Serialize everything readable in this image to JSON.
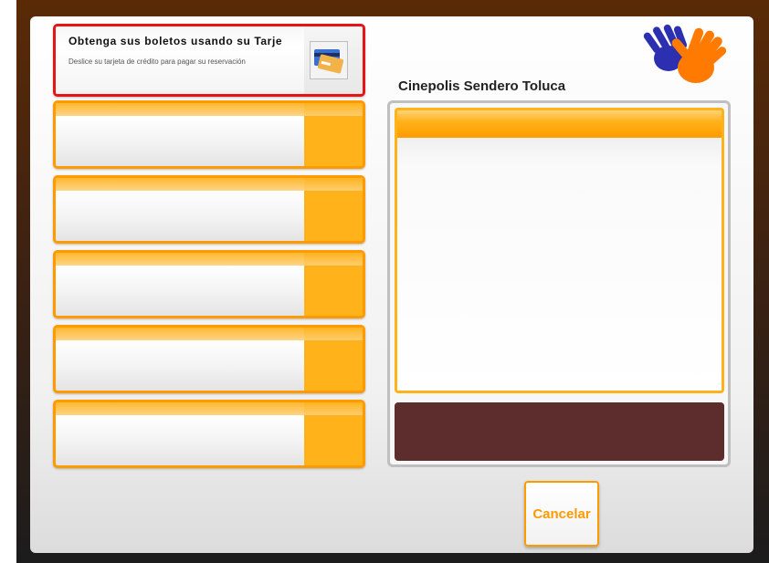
{
  "options": [
    {
      "title": "Obtenga sus boletos usando su Tarje",
      "subtitle": "Deslice su tarjeta de crédito para pagar su reservación",
      "icon": "credit-card-icon",
      "selected": true
    },
    {
      "title": "",
      "subtitle": ""
    },
    {
      "title": "",
      "subtitle": ""
    },
    {
      "title": "",
      "subtitle": ""
    },
    {
      "title": "",
      "subtitle": ""
    },
    {
      "title": "",
      "subtitle": ""
    }
  ],
  "venue": {
    "name": "Cinepolis Sendero Toluca"
  },
  "actions": {
    "cancel_label": "Cancelar"
  },
  "logo": {
    "icon": "hands-logo-icon"
  },
  "colors": {
    "accent": "#FFB21A",
    "accent_dark": "#FF9B00",
    "selected_border": "#E61414",
    "bottom_bar": "#5D2C2C",
    "logo_blue": "#2B2FB0",
    "logo_orange": "#FF7A00"
  }
}
